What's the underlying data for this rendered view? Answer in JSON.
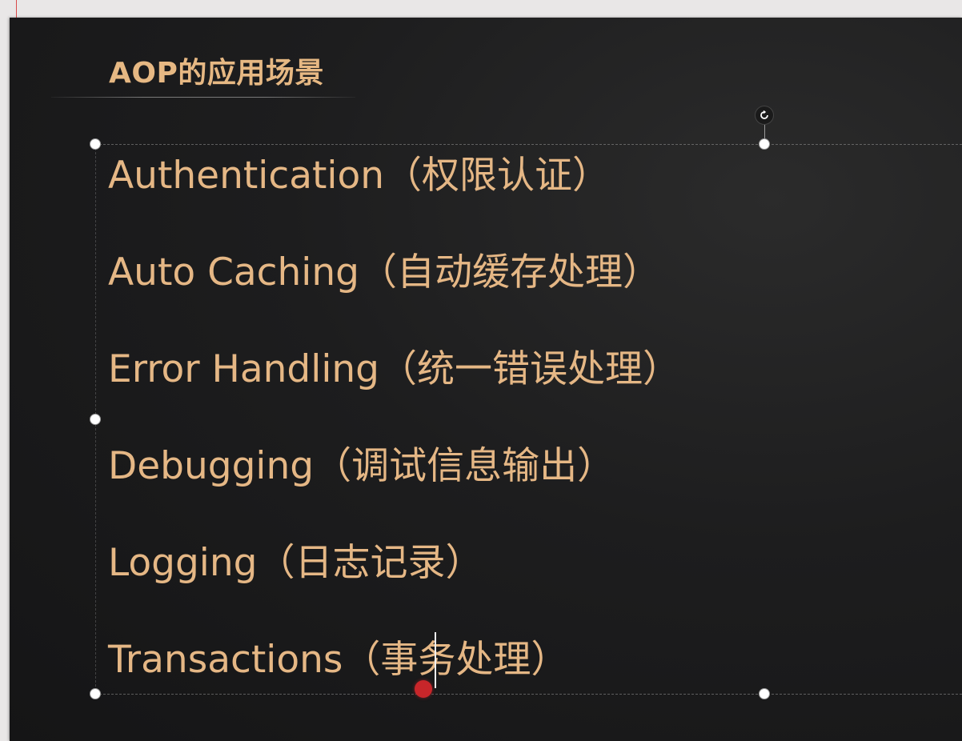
{
  "slide": {
    "title": "AOP的应用场景",
    "items": [
      "Authentication（权限认证）",
      "Auto Caching（自动缓存处理）",
      "Error Handling（统一错误处理）",
      "Debugging（调试信息输出）",
      "Logging（日志记录）",
      "Transactions（事务处理）"
    ]
  },
  "icons": {
    "rotate": "rotate-icon"
  },
  "colors": {
    "title": "#e6b883",
    "text": "#e5b785",
    "background": "#1d1d1e",
    "pointer": "#c8262a"
  }
}
